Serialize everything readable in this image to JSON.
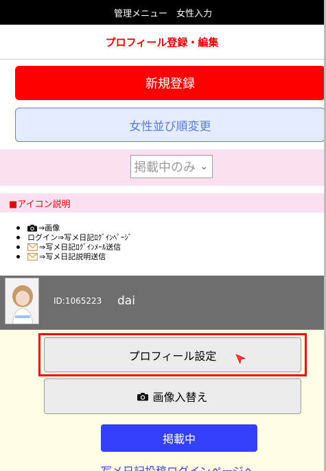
{
  "topbar": {
    "title": "管理メニュー　女性入力"
  },
  "subheader": {
    "title": "プロフィール登録・編集"
  },
  "buttons": {
    "new_register": "新規登録",
    "change_order": "女性並び順変更"
  },
  "filter": {
    "selected": "掲載中のみ"
  },
  "icon_legend": {
    "heading": "■アイコン説明",
    "items": [
      {
        "icon": "camera-icon",
        "text": "⇒画像"
      },
      {
        "icon": "",
        "text": "ログイン⇒写メ日記ﾛｸﾞｲﾝﾍﾟｰｼﾞ"
      },
      {
        "icon": "mail-icon",
        "text": "⇒写メ日記ﾛｸﾞｲﾝﾒｰﾙ送信"
      },
      {
        "icon": "mail-icon",
        "text": "⇒写メ日記説明送信"
      }
    ]
  },
  "profile": {
    "id_label": "ID:1065223",
    "name": "dai"
  },
  "actions": {
    "profile_settings": "プロフィール設定",
    "replace_image": "画像入替え",
    "published": "掲載中",
    "diary_login_link": "写メ日記投稿ログインページへ"
  },
  "colors": {
    "accent_red": "#ff0000",
    "pink_band": "#fbe1ef",
    "blue_button": "#3540ff",
    "cream_bg": "#fffee4"
  }
}
